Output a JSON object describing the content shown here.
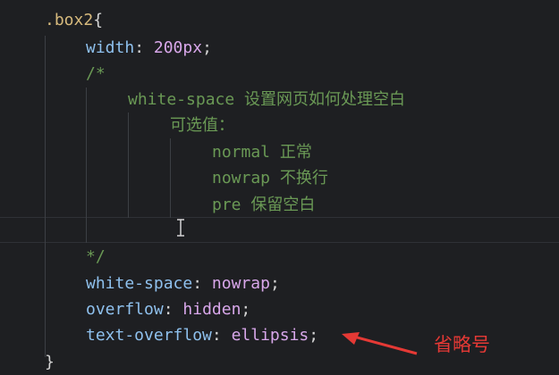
{
  "editor": {
    "lines": [
      {
        "tokens": [
          {
            "t": ".box2",
            "c": "sel"
          },
          {
            "t": "{",
            "c": "punc"
          }
        ]
      },
      {
        "tokens": [
          {
            "t": "width",
            "c": "prop"
          },
          {
            "t": ": ",
            "c": "punc"
          },
          {
            "t": "200px",
            "c": "val"
          },
          {
            "t": ";",
            "c": "punc"
          }
        ]
      },
      {
        "tokens": [
          {
            "t": "/*",
            "c": "cmt"
          }
        ]
      },
      {
        "tokens": [
          {
            "t": "white-space 设置网页如何处理空白",
            "c": "cmt"
          }
        ]
      },
      {
        "tokens": [
          {
            "t": "可选值：",
            "c": "cmt"
          }
        ]
      },
      {
        "tokens": [
          {
            "t": "normal 正常",
            "c": "cmt"
          }
        ]
      },
      {
        "tokens": [
          {
            "t": "nowrap 不换行",
            "c": "cmt"
          }
        ]
      },
      {
        "tokens": [
          {
            "t": "pre 保留空白",
            "c": "cmt"
          }
        ]
      },
      {
        "tokens": []
      },
      {
        "tokens": [
          {
            "t": "*/",
            "c": "cmt"
          }
        ]
      },
      {
        "tokens": [
          {
            "t": "white-space",
            "c": "prop"
          },
          {
            "t": ": ",
            "c": "punc"
          },
          {
            "t": "nowrap",
            "c": "val"
          },
          {
            "t": ";",
            "c": "punc"
          }
        ]
      },
      {
        "tokens": [
          {
            "t": "overflow",
            "c": "prop"
          },
          {
            "t": ": ",
            "c": "punc"
          },
          {
            "t": "hidden",
            "c": "val"
          },
          {
            "t": ";",
            "c": "punc"
          }
        ]
      },
      {
        "tokens": [
          {
            "t": "text-overflow",
            "c": "prop"
          },
          {
            "t": ": ",
            "c": "punc"
          },
          {
            "t": "ellipsis",
            "c": "val"
          },
          {
            "t": ";",
            "c": "punc"
          }
        ]
      },
      {
        "tokens": [
          {
            "t": "}",
            "c": "punc"
          }
        ]
      }
    ]
  },
  "annotation": {
    "label": "省略号",
    "color": "#e53935"
  },
  "colors": {
    "background": "#1e1f22",
    "selector": "#d7ba7d",
    "property": "#8fc1ee",
    "value": "#d8a7ea",
    "comment": "#6a9955"
  }
}
